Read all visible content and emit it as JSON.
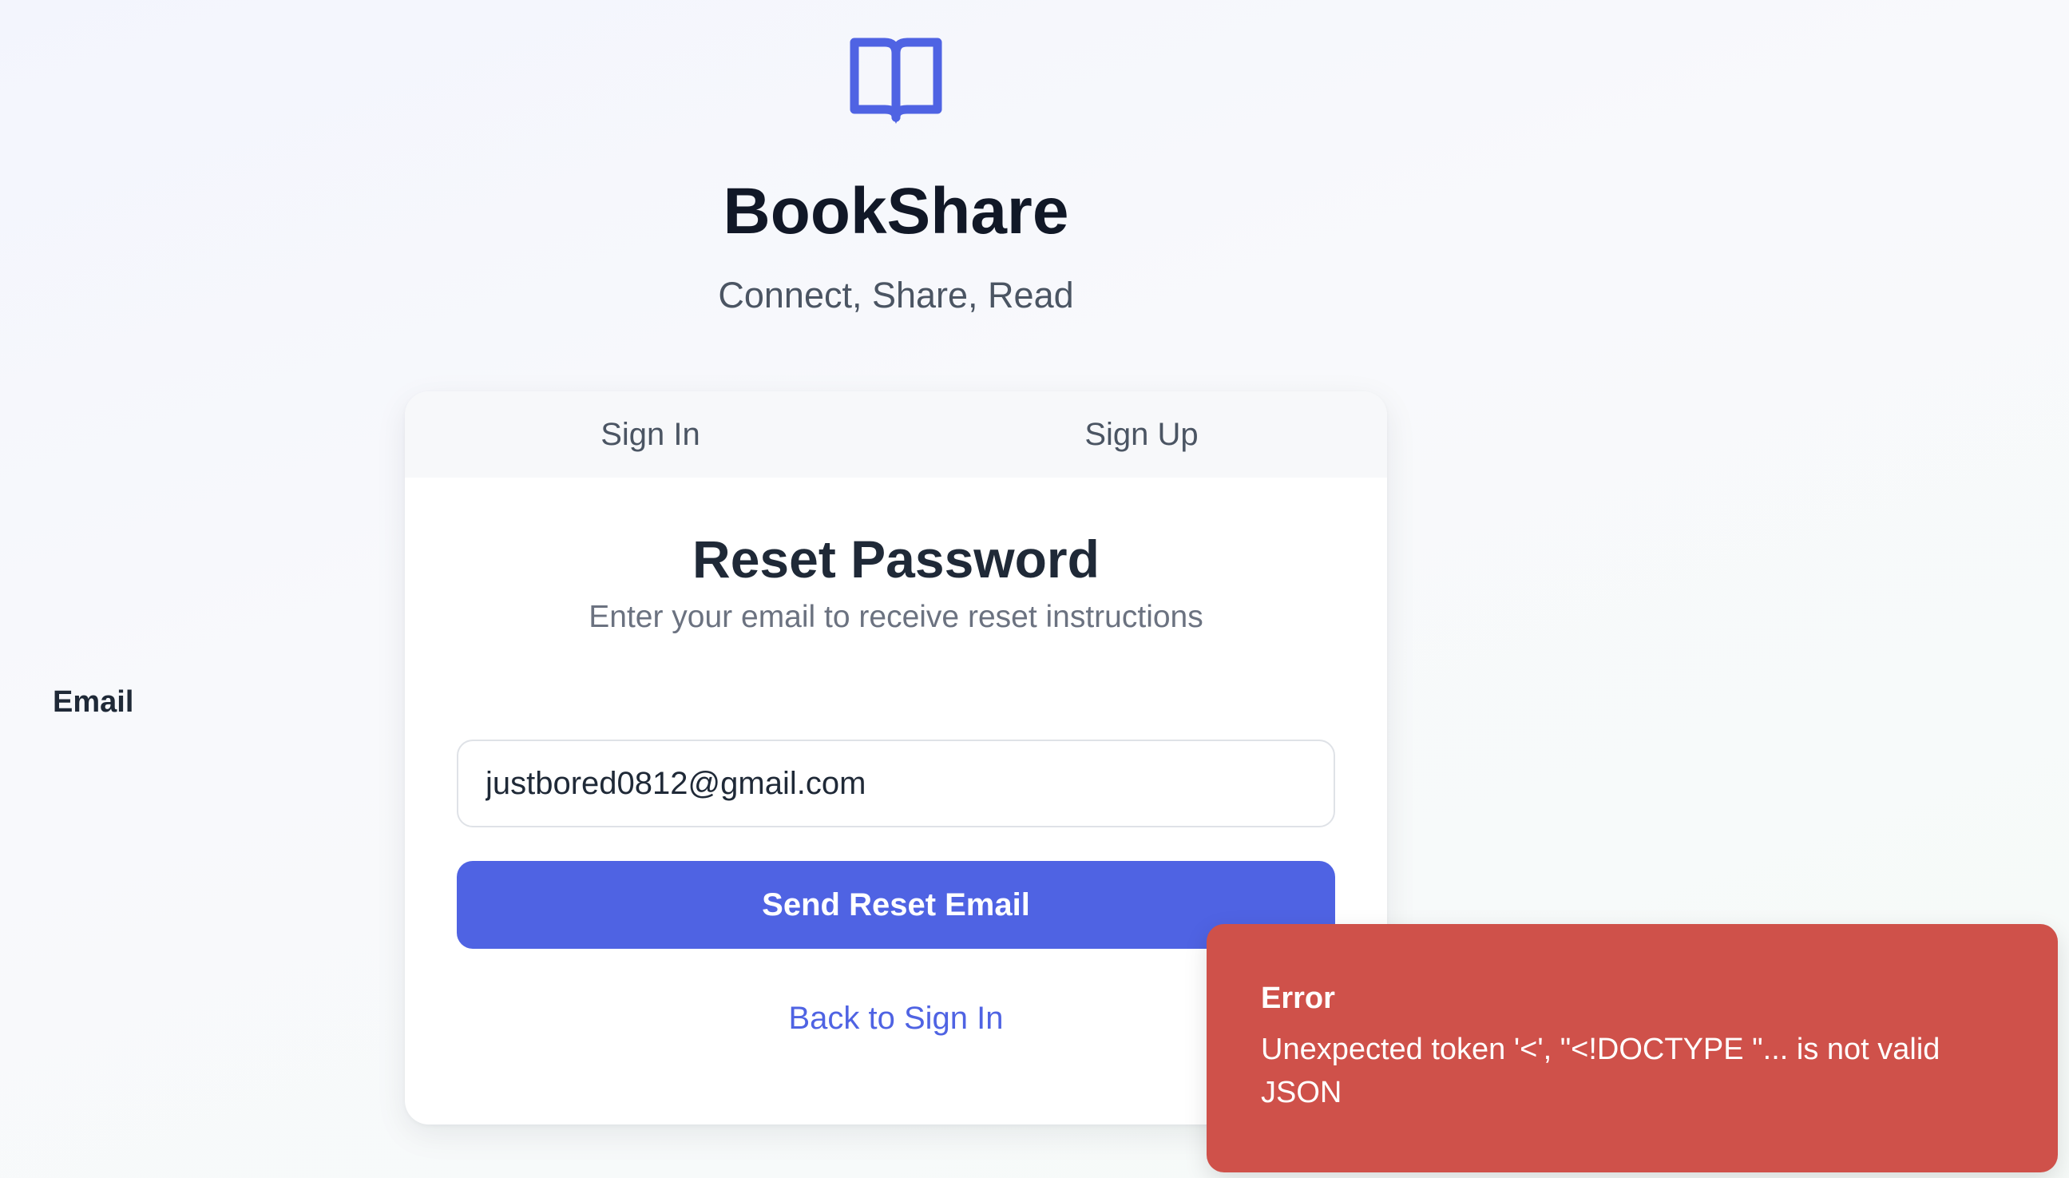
{
  "brand": {
    "title": "BookShare",
    "tagline": "Connect, Share, Read",
    "icon": "book-open-icon",
    "accent_color": "#4f63e3"
  },
  "auth_tabs": [
    {
      "label": "Sign In"
    },
    {
      "label": "Sign Up"
    }
  ],
  "reset_form": {
    "title": "Reset Password",
    "subtitle": "Enter your email to receive reset instructions",
    "email_label": "Email",
    "email_value": "justbored0812@gmail.com",
    "submit_label": "Send Reset Email",
    "back_link": "Back to Sign In"
  },
  "toast": {
    "title": "Error",
    "message": "Unexpected token '<', \"<!DOCTYPE \"... is not valid JSON",
    "color": "#cf514a"
  }
}
